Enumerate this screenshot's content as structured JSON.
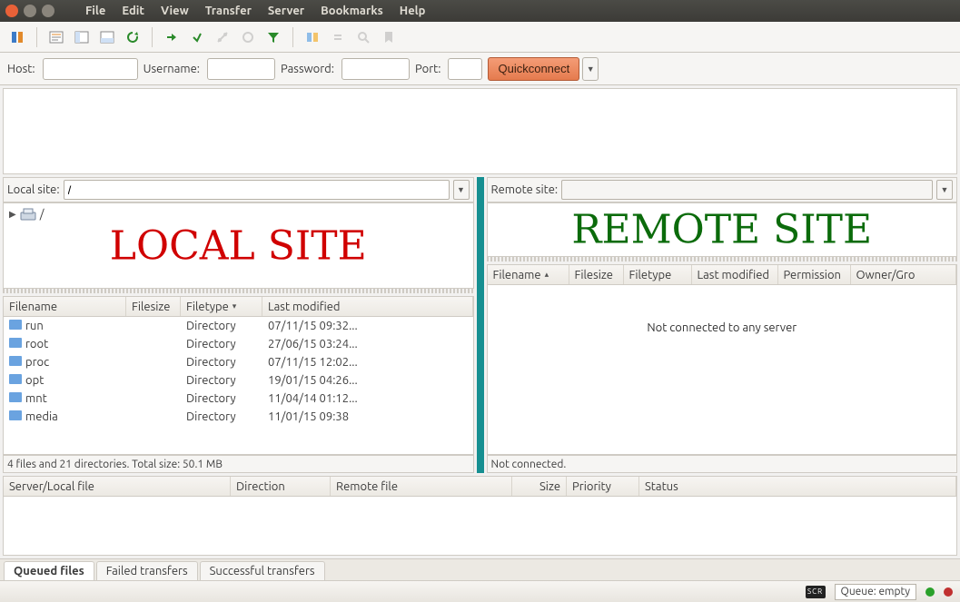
{
  "menus": {
    "file": "File",
    "edit": "Edit",
    "view": "View",
    "transfer": "Transfer",
    "server": "Server",
    "bookmarks": "Bookmarks",
    "help": "Help"
  },
  "quickbar": {
    "host_label": "Host:",
    "user_label": "Username:",
    "pass_label": "Password:",
    "port_label": "Port:",
    "connect": "Quickconnect"
  },
  "local": {
    "site_label": "Local site:",
    "path": "/",
    "overlay": "LOCAL SITE",
    "headers": {
      "filename": "Filename",
      "filesize": "Filesize",
      "filetype": "Filetype",
      "modified": "Last modified"
    },
    "rows": [
      {
        "name": "run",
        "size": "",
        "type": "Directory",
        "mod": "07/11/15 09:32..."
      },
      {
        "name": "root",
        "size": "",
        "type": "Directory",
        "mod": "27/06/15 03:24..."
      },
      {
        "name": "proc",
        "size": "",
        "type": "Directory",
        "mod": "07/11/15 12:02..."
      },
      {
        "name": "opt",
        "size": "",
        "type": "Directory",
        "mod": "19/01/15 04:26..."
      },
      {
        "name": "mnt",
        "size": "",
        "type": "Directory",
        "mod": "11/04/14 01:12..."
      },
      {
        "name": "media",
        "size": "",
        "type": "Directory",
        "mod": "11/01/15 09:38"
      }
    ],
    "status": "4 files and 21 directories. Total size: 50.1 MB"
  },
  "remote": {
    "site_label": "Remote site:",
    "overlay": "REMOTE SITE",
    "headers": {
      "filename": "Filename",
      "filesize": "Filesize",
      "filetype": "Filetype",
      "modified": "Last modified",
      "perm": "Permission",
      "owner": "Owner/Gro"
    },
    "empty_msg": "Not connected to any server",
    "status": "Not connected."
  },
  "transfer": {
    "headers": {
      "serverlocal": "Server/Local file",
      "direction": "Direction",
      "remotefile": "Remote file",
      "size": "Size",
      "priority": "Priority",
      "status": "Status"
    },
    "tabs": {
      "queued": "Queued files",
      "failed": "Failed transfers",
      "success": "Successful transfers"
    }
  },
  "bottom": {
    "queue": "Queue: empty"
  }
}
